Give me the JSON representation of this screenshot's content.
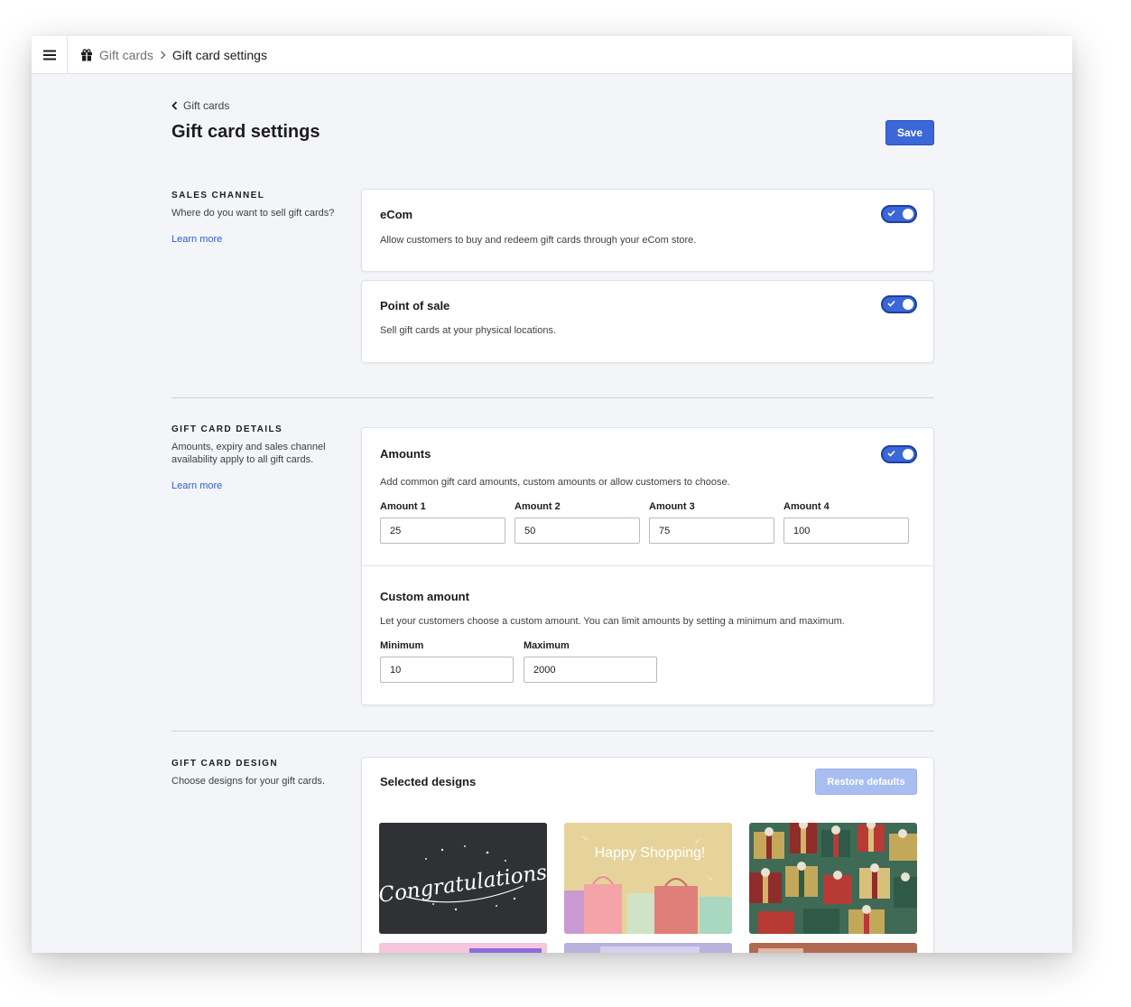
{
  "topbar": {
    "breadcrumb_parent": "Gift cards",
    "breadcrumb_current": "Gift card settings"
  },
  "header": {
    "back_label": "Gift cards",
    "title": "Gift card settings",
    "save_label": "Save"
  },
  "sales_channel": {
    "heading": "SALES CHANNEL",
    "description": "Where do you want to sell gift cards?",
    "learn_more": "Learn more",
    "ecom": {
      "title": "eCom",
      "description": "Allow customers to buy and redeem gift cards through your eCom store.",
      "enabled": true
    },
    "pos": {
      "title": "Point of sale",
      "description": "Sell gift cards at your physical locations.",
      "enabled": true
    }
  },
  "details": {
    "heading": "GIFT CARD DETAILS",
    "description": "Amounts, expiry and sales channel availability apply to all gift cards.",
    "learn_more": "Learn more",
    "amounts": {
      "title": "Amounts",
      "description": "Add common gift card amounts, custom amounts or allow customers to choose.",
      "enabled": true,
      "fields": [
        {
          "label": "Amount 1",
          "value": "25"
        },
        {
          "label": "Amount 2",
          "value": "50"
        },
        {
          "label": "Amount 3",
          "value": "75"
        },
        {
          "label": "Amount 4",
          "value": "100"
        }
      ]
    },
    "custom": {
      "title": "Custom amount",
      "description": "Let your customers choose a custom amount. You can limit amounts by setting a minimum and maximum.",
      "min_label": "Minimum",
      "min_value": "10",
      "max_label": "Maximum",
      "max_value": "2000"
    }
  },
  "design": {
    "heading": "GIFT CARD DESIGN",
    "description": "Choose designs for your gift cards.",
    "selected_title": "Selected designs",
    "restore_label": "Restore defaults",
    "thumbs": [
      {
        "text": "Congratulations",
        "bg": "#2f3135"
      },
      {
        "text": "Happy Shopping!",
        "bg": "#e6d39a"
      },
      {
        "text": "",
        "bg": "#3f6a55"
      }
    ]
  },
  "colors": {
    "accent": "#3c67d9",
    "link": "#2b5fd9"
  }
}
